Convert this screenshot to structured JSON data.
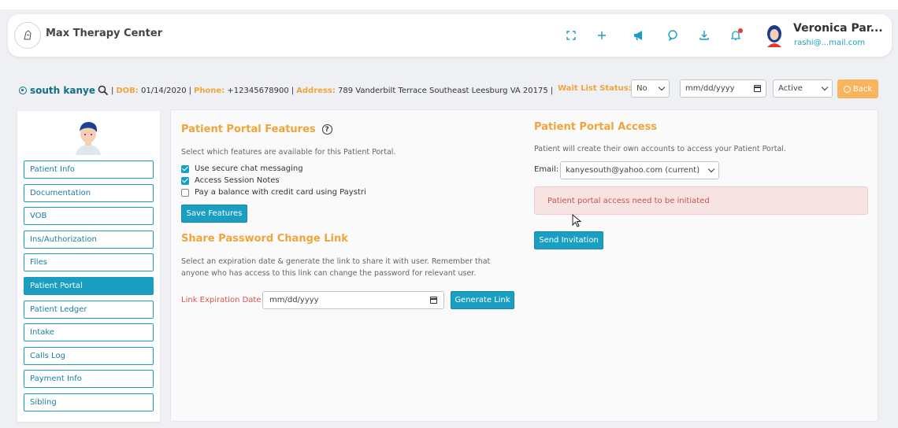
{
  "header": {
    "app_title": "Max Therapy Center",
    "user_name": "Veronica Par...",
    "user_email": "rashi@...mail.com",
    "icons": [
      "fullscreen-icon",
      "plus-icon",
      "megaphone-icon",
      "chat-icon",
      "download-icon",
      "bell-icon"
    ]
  },
  "patient": {
    "name": "south kanye",
    "dob_label": "DOB:",
    "dob": "01/14/2020",
    "phone_label": "Phone:",
    "phone": "+12345678900",
    "address_label": "Address:",
    "address": "789 Vanderbilt Terrace Southeast Leesburg VA 20175",
    "separator": "|"
  },
  "controls": {
    "wait_list_label": "Wait List Status:",
    "wait_list_value": "No",
    "date_placeholder": "mm/dd/yyyy",
    "status_value": "Active",
    "back_label": "Back"
  },
  "sidebar": {
    "items": [
      {
        "label": "Patient Info"
      },
      {
        "label": "Documentation"
      },
      {
        "label": "VOB"
      },
      {
        "label": "Ins/Authorization"
      },
      {
        "label": "Files"
      },
      {
        "label": "Patient Portal",
        "active": true
      },
      {
        "label": "Patient Ledger"
      },
      {
        "label": "Intake"
      },
      {
        "label": "Calls Log"
      },
      {
        "label": "Payment Info"
      },
      {
        "label": "Sibling"
      }
    ]
  },
  "features": {
    "title": "Patient Portal Features",
    "help": "?",
    "description": "Select which features are available for this Patient Portal.",
    "options": [
      {
        "label": "Use secure chat messaging",
        "checked": true
      },
      {
        "label": "Access Session Notes",
        "checked": true
      },
      {
        "label": "Pay a balance with credit card using Paystri",
        "checked": false
      }
    ],
    "save_label": "Save Features"
  },
  "share": {
    "title": "Share Password Change Link",
    "description_line1": "Select an expiration date & generate the link to share it with user. Remember that",
    "description_line2": "anyone who has access to this link can change the password for relevant user.",
    "expiration_label": "Link Expiration Date",
    "date_placeholder": "mm/dd/yyyy",
    "generate_label": "Generate Link"
  },
  "access": {
    "title": "Patient Portal Access",
    "description": "Patient will create their own accounts to access your Patient Portal.",
    "email_label": "Email:",
    "email_value": "kanyesouth@yahoo.com (current)",
    "alert": "Patient portal access need to be initiated",
    "send_label": "Send Invitation"
  },
  "colors": {
    "accent": "#1a9fc2",
    "orange": "#f0a53a",
    "alert_bg": "#f8e3e3"
  }
}
